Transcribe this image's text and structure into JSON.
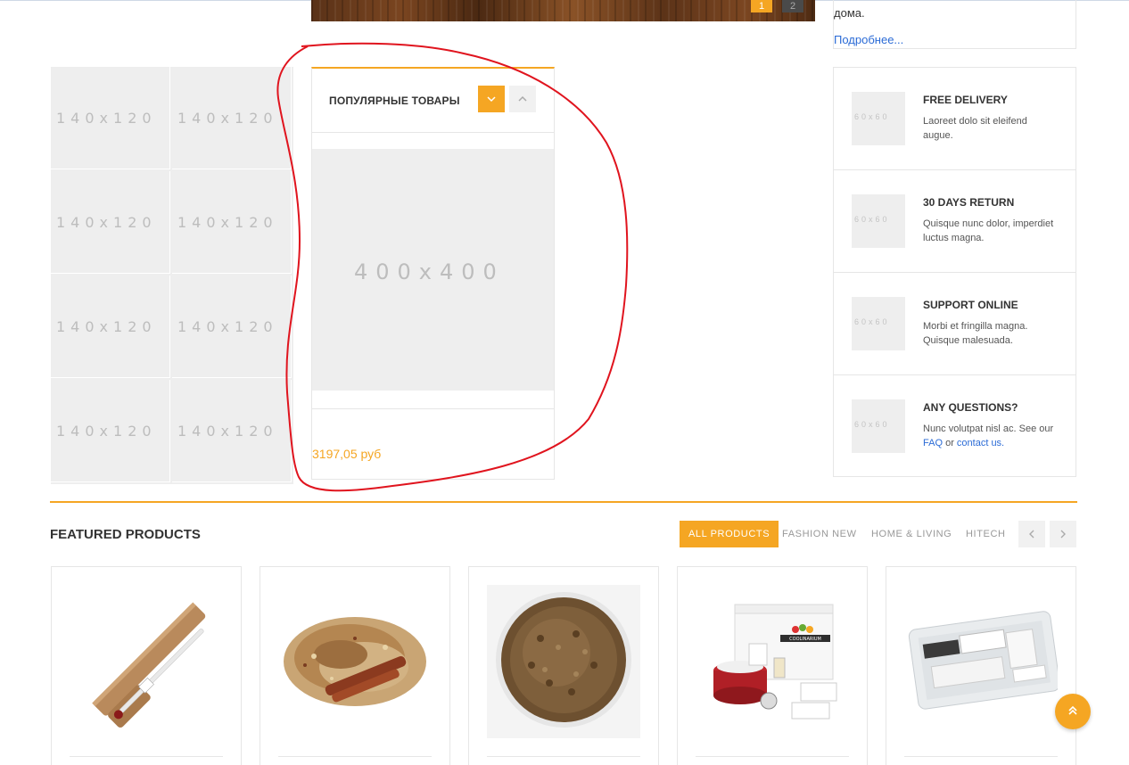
{
  "hero": {
    "pages": [
      "1",
      "2"
    ]
  },
  "about": {
    "text_tail": "дома.",
    "more_link": "Подробнее..."
  },
  "thumb_grid": {
    "placeholder": "140x120",
    "count": 8
  },
  "popular": {
    "title": "ПОПУЛЯРНЫЕ ТОВАРЫ",
    "image_placeholder": "400x400",
    "price": "3197,05 руб",
    "prev_icon": "chevron-down-icon",
    "next_icon": "chevron-up-icon"
  },
  "features": [
    {
      "placeholder": "60x60",
      "title": "FREE DELIVERY",
      "desc": "Laoreet dolo sit eleifend augue."
    },
    {
      "placeholder": "60x60",
      "title": "30 DAYS RETURN",
      "desc": "Quisque nunc dolor, imperdiet luctus magna."
    },
    {
      "placeholder": "60x60",
      "title": "SUPPORT ONLINE",
      "desc": "Morbi et fringilla magna. Quisque malesuada."
    },
    {
      "placeholder": "60x60",
      "title": "ANY QUESTIONS?",
      "desc_pre": "Nunc volutpat nisl ac. See our",
      "faq_link": "FAQ",
      "desc_mid": "or",
      "contact_link": "contact us."
    }
  ],
  "featured": {
    "title": "FEATURED PRODUCTS",
    "tabs": [
      "ALL PRODUCTS",
      "FASHION NEW",
      "HOME & LIVING",
      "HITECH"
    ],
    "active_tab": "ALL PRODUCTS",
    "prev_icon": "chevron-left-icon",
    "next_icon": "chevron-right-icon",
    "products": [
      {
        "image": "hydrometer-tube-image"
      },
      {
        "image": "spice-mix-cinnamon-image"
      },
      {
        "image": "anise-seeds-bowl-image"
      },
      {
        "image": "coolinarium-kit-image",
        "brand": "COOLINARIUM"
      },
      {
        "image": "wine-kit-bag-image"
      }
    ]
  },
  "colors": {
    "accent": "#f5a623",
    "link": "#2b6bd6",
    "annotation": "#e0141e",
    "placeholder_bg": "#eeeeee"
  },
  "back_to_top_icon": "double-chevron-up-icon"
}
